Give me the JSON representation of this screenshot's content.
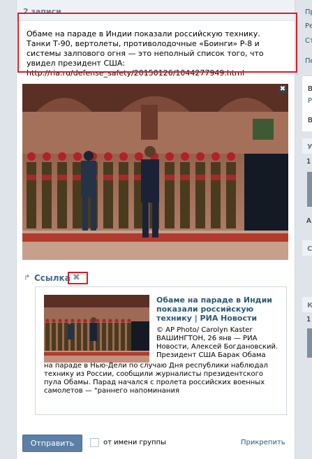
{
  "header": {
    "records_count": "2 записи"
  },
  "post": {
    "text": "Обаме на параде в Индии показали российскую технику. Танки Т-90, вертолеты, противолодочные «Боинги» P-8 и системы залпового огня — это неполный список того, что увидел президент США: http://ria.ru/defense_safety/20150126/1044277949.html"
  },
  "photo": {
    "close_glyph": "✖"
  },
  "attachment": {
    "kind_label": "Ссылка",
    "remove_glyph": "✖",
    "title": "Обаме на параде в Индии показали российскую технику | РИА Новости",
    "desc_top": "© AP Photo/ Carolyn Kaster ВАШИНГТОН, 26 янв — РИА Новости, Алексей Богдановский. Президент США Барак Обама",
    "desc_bottom": "на параде в Нью-Дели по случаю Дня республики наблюдал технику из России, сообщили журналисты президентского пула Обамы. Парад начался с пролета российских военных самолетов — \"раннего напоминания"
  },
  "actions": {
    "send_label": "Отправить",
    "group_label": "от имени группы",
    "attach_label": "Прикрепить"
  },
  "sidebar": {
    "items": [
      "Пр",
      "Ре",
      "Ст",
      "Пе"
    ],
    "b1": "В",
    "b2": "Р",
    "b3": "В",
    "h1": "У",
    "n1": "1",
    "a1": "А",
    "h2": "С",
    "h3": "К",
    "n2": "1"
  }
}
